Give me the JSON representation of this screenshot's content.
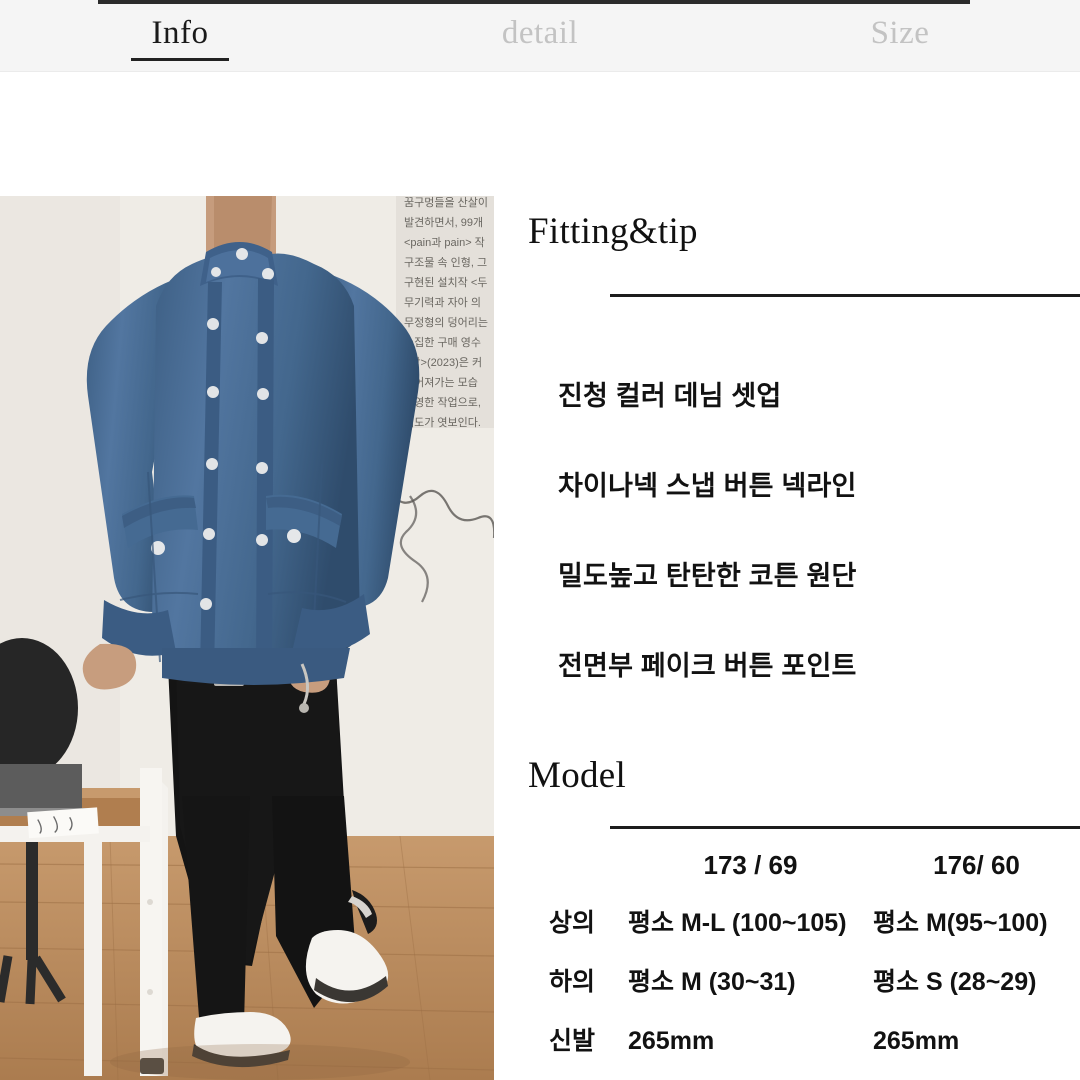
{
  "tabs": [
    {
      "label": "Info",
      "active": true
    },
    {
      "label": "detail",
      "active": false
    },
    {
      "label": "Size",
      "active": false
    }
  ],
  "photo": {
    "alt": "model-wearing-denim-jacket-and-black-wide-pants-in-gallery",
    "wall_text": [
      "꿈구멍들을 산살이",
      "발견하면서, 99개",
      "<pain과 pain> 작",
      "구조물 속 인형, 그",
      "구현된 설치작 <두",
      "무기력과 자아 의",
      "무정형의 덩어리는",
      "수집한 구매 영수",
      "<낙>(2023)은 커",
      "떨어져가는 모습",
      "투영한 작업으로,",
      "태도가 엿보인다."
    ],
    "colors": {
      "wall": "#ece9e3",
      "denim": "#4a6d93",
      "denim_dark": "#34516f",
      "pants": "#141414",
      "shoes": "#f4f2ee",
      "floor": "#b98a5c",
      "desk_top": "#b58150",
      "desk_frame": "#f2f0ec",
      "chair": "#2b2b2b",
      "shirt": "#e8e2d6",
      "skin": "#c39a7c"
    }
  },
  "fitting": {
    "title": "Fitting&tip",
    "bullets": [
      "진청 컬러 데님 셋업",
      "차이나넥 스냅 버튼 넥라인",
      "밀도높고 탄탄한 코튼 원단",
      "전면부 페이크 버튼 포인트"
    ]
  },
  "model": {
    "title": "Model",
    "columns": [
      "173 / 69",
      "176/ 60"
    ],
    "rows": [
      {
        "label": "상의",
        "values": [
          "평소 M-L (100~105)",
          "평소 M(95~100)"
        ]
      },
      {
        "label": "하의",
        "values": [
          "평소 M (30~31)",
          "평소 S (28~29)"
        ]
      },
      {
        "label": "신발",
        "values": [
          "265mm",
          "265mm"
        ]
      }
    ]
  },
  "theme": {
    "tabbar_bg": "#f5f5f5",
    "active_tab": "#1a1a1a",
    "inactive_tab": "#c3c3c3",
    "rule": "#1d1d1d",
    "page_bg": "#ffffff"
  }
}
